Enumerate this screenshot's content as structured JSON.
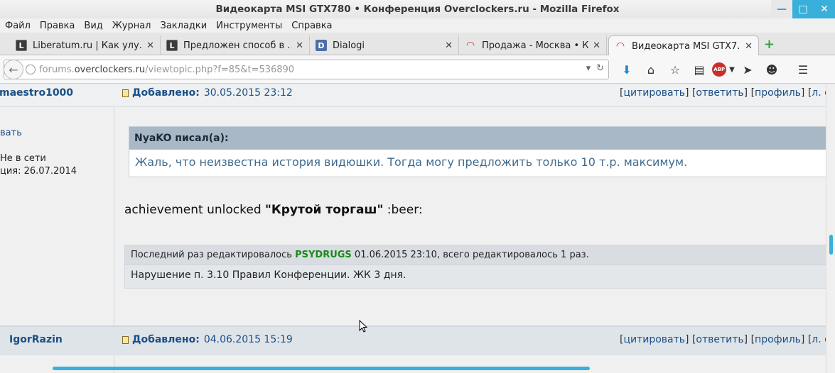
{
  "window": {
    "title": "Видеокарта MSI GTX780 • Конференция Overclockers.ru - Mozilla Firefox",
    "minimize": "—",
    "maximize": "□",
    "close": "✕"
  },
  "menu": [
    "Файл",
    "Правка",
    "Вид",
    "Журнал",
    "Закладки",
    "Инструменты",
    "Справка"
  ],
  "tabs": [
    {
      "title": "Liberatum.ru | Как улу...",
      "favicon": "L"
    },
    {
      "title": "Предложен способ в ...",
      "favicon": "L"
    },
    {
      "title": "Dialogi",
      "favicon": "D"
    },
    {
      "title": "Продажа - Москва • К...",
      "favicon": "oc"
    },
    {
      "title": "Видеокарта MSI GTX7...",
      "favicon": "oc",
      "active": true
    }
  ],
  "tab_close": "✕",
  "newtab": "+",
  "url": {
    "prefix": "forums.",
    "host": "overclockers.ru",
    "path": "/viewtopic.php?f=85&t=536890"
  },
  "icons": {
    "download": "download-icon",
    "home": "home-icon",
    "bookmark": "star-icon",
    "reader": "reader-icon",
    "adblock": "ABP",
    "send": "send-icon",
    "emoji": "face-icon",
    "menu": "hamburger-icon"
  },
  "post1": {
    "author": "maestro1000",
    "posted_label": "Добавлено:",
    "posted_date": "30.05.2015 23:12",
    "actions": [
      "цитировать",
      "ответить",
      "профиль",
      "л. с"
    ],
    "side_link": "вать",
    "status": "Не в сети",
    "registered": "ция: 26.07.2014",
    "quote_author": "NyaKO писал(а):",
    "quote_text": "Жаль, что неизвестна история видюшки. Тогда могу предложить только 10 т.р. максимум.",
    "text_before": "achievement unlocked ",
    "text_bold": "\"Крутой торгаш\"",
    "text_after": " :beer:",
    "edit_prefix": "Последний раз редактировалось ",
    "edit_mod": "PSYDRUGS",
    "edit_suffix": " 01.06.2015 23:10, всего редактировалось 1 раз.",
    "edit_note": "Нарушение п. 3.10 Правил Конференции. ЖК 3 дня."
  },
  "post2": {
    "author": "IgorRazin",
    "posted_label": "Добавлено:",
    "posted_date": "04.06.2015 15:19",
    "actions": [
      "цитировать",
      "ответить",
      "профиль",
      "л. с"
    ]
  },
  "colors": {
    "accent": "#39b0d9",
    "link": "#1a4f86",
    "moderator": "#1b8a1b"
  }
}
